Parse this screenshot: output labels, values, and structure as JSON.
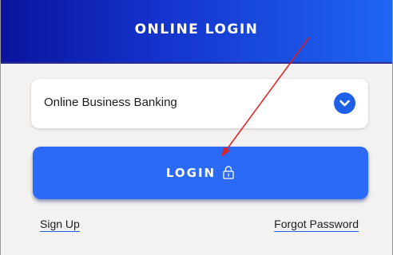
{
  "header": {
    "title": "ONLINE LOGIN"
  },
  "select": {
    "value": "Online Business Banking",
    "icon": "chevron-down-icon"
  },
  "login_button": {
    "label": "LOGIN",
    "icon": "lock-icon"
  },
  "links": {
    "sign_up": "Sign Up",
    "forgot_password": "Forgot Password"
  },
  "colors": {
    "header_start": "#0a149c",
    "header_end": "#1f66f2",
    "button": "#2a6af5",
    "chevron_circle": "#1e5fe8",
    "panel_bg": "#f3f2f0",
    "annotation_arrow": "#e02020"
  }
}
